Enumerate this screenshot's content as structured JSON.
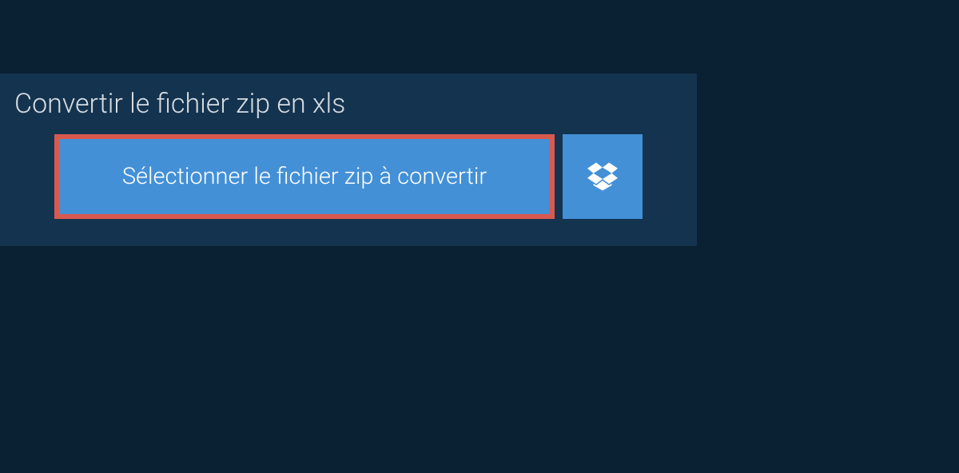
{
  "header": {
    "title": "Convertir le fichier zip en xls"
  },
  "actions": {
    "select_file_label": "Sélectionner le fichier zip à convertir"
  },
  "colors": {
    "background": "#0a2033",
    "panel": "#14334f",
    "button": "#4490d7",
    "highlight_border": "#d85a4f",
    "text_light": "#d6dde3",
    "text_white": "#ffffff"
  }
}
